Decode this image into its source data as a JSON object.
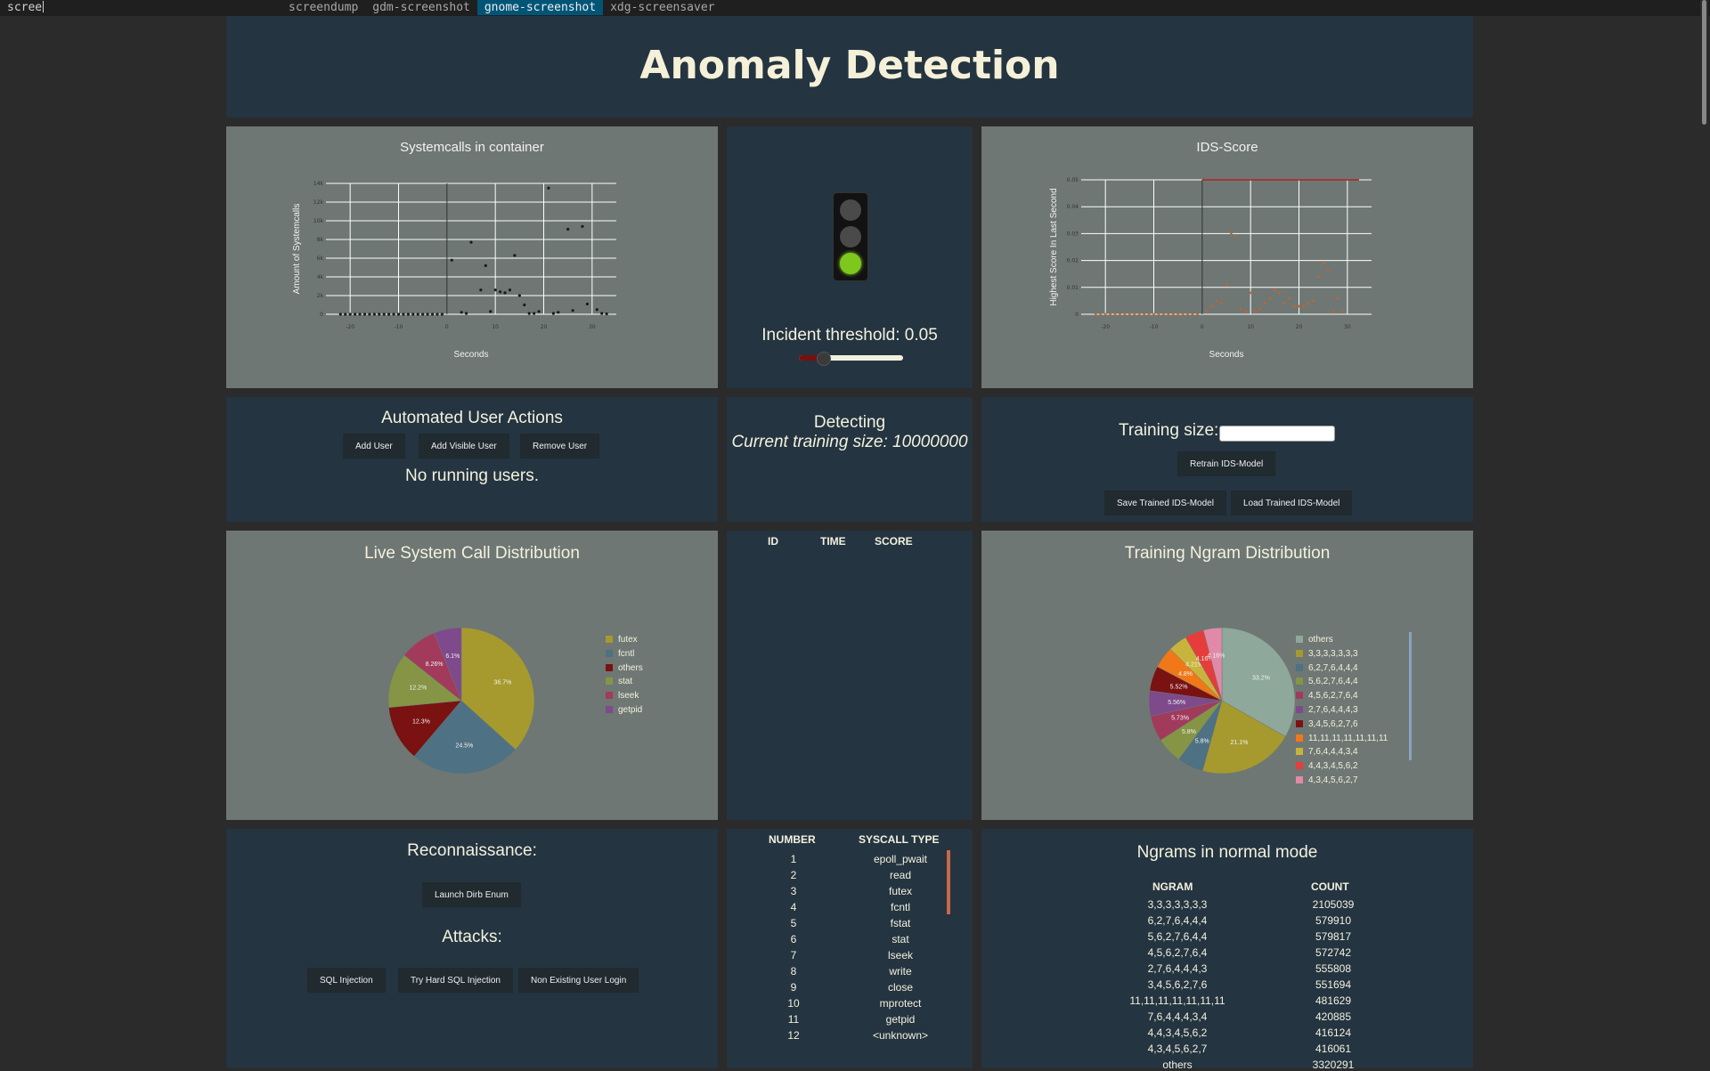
{
  "launcher": {
    "query": "scree",
    "items": [
      "screendump",
      "gdm-screenshot",
      "gnome-screenshot",
      "xdg-screensaver"
    ],
    "selected_index": 2
  },
  "header": {
    "title": "Anomaly Detection"
  },
  "syscall_chart": {
    "title": "Systemcalls in container",
    "chart_data": {
      "type": "scatter",
      "xlabel": "Seconds",
      "ylabel": "Amount of Systemcalls",
      "xlim": [
        -25,
        35
      ],
      "ylim": [
        0,
        14000
      ],
      "x_ticks": [
        "-20",
        "-10",
        "0",
        "10",
        "20",
        "30"
      ],
      "y_ticks": [
        "0",
        "2k",
        "4k",
        "6k",
        "8k",
        "10k",
        "12k",
        "14k"
      ],
      "grid": true,
      "points": [
        {
          "x": 1,
          "y": 5800
        },
        {
          "x": 3,
          "y": 200
        },
        {
          "x": 4,
          "y": 100
        },
        {
          "x": 5,
          "y": 7700
        },
        {
          "x": 7,
          "y": 2600
        },
        {
          "x": 8,
          "y": 5200
        },
        {
          "x": 9,
          "y": 300
        },
        {
          "x": 10,
          "y": 2600
        },
        {
          "x": 11,
          "y": 2400
        },
        {
          "x": 12,
          "y": 2300
        },
        {
          "x": 13,
          "y": 2600
        },
        {
          "x": 14,
          "y": 6300
        },
        {
          "x": 15,
          "y": 2000
        },
        {
          "x": 16,
          "y": 1000
        },
        {
          "x": 17,
          "y": 100
        },
        {
          "x": 18,
          "y": 100
        },
        {
          "x": 19,
          "y": 300
        },
        {
          "x": 21,
          "y": 13500
        },
        {
          "x": 22,
          "y": 100
        },
        {
          "x": 23,
          "y": 200
        },
        {
          "x": 25,
          "y": 9100
        },
        {
          "x": 26,
          "y": 400
        },
        {
          "x": 28,
          "y": 9400
        },
        {
          "x": 29,
          "y": 1100
        },
        {
          "x": 31,
          "y": 500
        },
        {
          "x": 32,
          "y": 100
        },
        {
          "x": 33,
          "y": 50
        }
      ]
    }
  },
  "traffic_light": {
    "state": "green",
    "threshold_label": "Incident threshold: 0.05",
    "slider_value_fraction": 0.2
  },
  "ids_chart": {
    "title": "IDS-Score",
    "chart_data": {
      "type": "scatter",
      "xlabel": "Seconds",
      "ylabel": "Highest Score In Last Second",
      "xlim": [
        -25,
        35
      ],
      "ylim": [
        0,
        0.05
      ],
      "threshold": 0.05,
      "x_ticks": [
        "-20",
        "-10",
        "0",
        "10",
        "20",
        "30"
      ],
      "y_ticks": [
        "0",
        "0.01",
        "0.02",
        "0.03",
        "0.04",
        "0.05"
      ],
      "grid": true,
      "points": [
        {
          "x": 1,
          "y": 0.001
        },
        {
          "x": 2,
          "y": 0.003
        },
        {
          "x": 3,
          "y": 0.005
        },
        {
          "x": 4,
          "y": 0.004
        },
        {
          "x": 5,
          "y": 0.011
        },
        {
          "x": 6,
          "y": 0.03
        },
        {
          "x": 7,
          "y": 0.029
        },
        {
          "x": 8,
          "y": 0.002
        },
        {
          "x": 9,
          "y": 0.001
        },
        {
          "x": 10,
          "y": 0.008
        },
        {
          "x": 11,
          "y": 0.001
        },
        {
          "x": 12,
          "y": 0.002
        },
        {
          "x": 13,
          "y": 0.004
        },
        {
          "x": 14,
          "y": 0.006
        },
        {
          "x": 15,
          "y": 0.009
        },
        {
          "x": 16,
          "y": 0.008
        },
        {
          "x": 17,
          "y": 0.004
        },
        {
          "x": 18,
          "y": 0.006
        },
        {
          "x": 19,
          "y": 0.003
        },
        {
          "x": 20,
          "y": 0.003
        },
        {
          "x": 21,
          "y": 0.003
        },
        {
          "x": 22,
          "y": 0.004
        },
        {
          "x": 23,
          "y": 0.005
        },
        {
          "x": 24,
          "y": 0.014
        },
        {
          "x": 25,
          "y": 0.019
        },
        {
          "x": 26,
          "y": 0.016
        },
        {
          "x": 27,
          "y": 0.001
        },
        {
          "x": 28,
          "y": 0.006
        },
        {
          "x": 29,
          "y": 0.001
        }
      ]
    }
  },
  "user_actions": {
    "title": "Automated User Actions",
    "buttons": [
      "Add User",
      "Add Visible User",
      "Remove User"
    ],
    "status": "No running users."
  },
  "detecting": {
    "status": "Detecting",
    "training_size_text": "Current training size: 10000000"
  },
  "training": {
    "label": "Training size:",
    "input_value": "",
    "retrain_label": "Retrain IDS-Model",
    "save_label": "Save Trained IDS-Model",
    "load_label": "Load Trained IDS-Model"
  },
  "live_distribution": {
    "title": "Live System Call Distribution",
    "chart_data": {
      "type": "pie",
      "slices": [
        {
          "label": "futex",
          "value": 36.7,
          "text": "36.7%",
          "color": "#a69a2e"
        },
        {
          "label": "fcntl",
          "value": 24.5,
          "text": "24.5%",
          "color": "#4e7183"
        },
        {
          "label": "others",
          "value": 12.3,
          "text": "12.3%",
          "color": "#7a1212"
        },
        {
          "label": "stat",
          "value": 12.2,
          "text": "12.2%",
          "color": "#859545"
        },
        {
          "label": "lseek",
          "value": 8.2,
          "text": "8.26%",
          "color": "#a23a5c"
        },
        {
          "label": "getpid",
          "value": 6.1,
          "text": "6.1%",
          "color": "#7e4a8b"
        }
      ]
    }
  },
  "incidents": {
    "headers": [
      "ID",
      "TIME",
      "SCORE"
    ],
    "rows": []
  },
  "training_ngram": {
    "title": "Training Ngram Distribution",
    "chart_data": {
      "type": "pie",
      "slices": [
        {
          "label": "others",
          "value": 33.2,
          "text": "33.2%",
          "color": "#8ea89b"
        },
        {
          "label": "3,3,3,3,3,3,3",
          "value": 21.1,
          "text": "21.1%",
          "color": "#a69a2e"
        },
        {
          "label": "6,2,7,6,4,4,4",
          "value": 5.8,
          "text": "5.8%",
          "color": "#4e7183"
        },
        {
          "label": "5,6,2,7,6,4,4",
          "value": 5.8,
          "text": "5.8%",
          "color": "#859545"
        },
        {
          "label": "4,5,6,2,7,6,4",
          "value": 5.7,
          "text": "5.73%",
          "color": "#a23a5c"
        },
        {
          "label": "2,7,6,4,4,4,3",
          "value": 5.6,
          "text": "5.56%",
          "color": "#7e4a8b"
        },
        {
          "label": "3,4,5,6,2,7,6",
          "value": 5.5,
          "text": "5.52%",
          "color": "#7a1212"
        },
        {
          "label": "11,11,11,11,11,11,11",
          "value": 4.8,
          "text": "4.8%",
          "color": "#f07818"
        },
        {
          "label": "7,6,4,4,4,3,4",
          "value": 4.2,
          "text": "4.21%",
          "color": "#c8b43c"
        },
        {
          "label": "4,4,3,4,5,6,2",
          "value": 4.2,
          "text": "4.16%",
          "color": "#e63c3c"
        },
        {
          "label": "4,3,4,5,6,2,7",
          "value": 4.1,
          "text": "4.16%",
          "color": "#e08aa8"
        }
      ]
    }
  },
  "attacks": {
    "recon_title": "Reconnaissance:",
    "recon_buttons": [
      "Launch Dirb Enum"
    ],
    "attacks_title": "Attacks:",
    "attack_buttons": [
      "SQL Injection",
      "Try Hard SQL Injection",
      "Non Existing User Login"
    ]
  },
  "syscall_table": {
    "headers": [
      "NUMBER",
      "SYSCALL TYPE"
    ],
    "rows": [
      [
        "1",
        "epoll_pwait"
      ],
      [
        "2",
        "read"
      ],
      [
        "3",
        "futex"
      ],
      [
        "4",
        "fcntl"
      ],
      [
        "5",
        "fstat"
      ],
      [
        "6",
        "stat"
      ],
      [
        "7",
        "lseek"
      ],
      [
        "8",
        "write"
      ],
      [
        "9",
        "close"
      ],
      [
        "10",
        "mprotect"
      ],
      [
        "11",
        "getpid"
      ],
      [
        "12",
        "<unknown>"
      ]
    ]
  },
  "ngrams_normal": {
    "title": "Ngrams in normal mode",
    "headers": [
      "NGRAM",
      "COUNT"
    ],
    "rows": [
      [
        "3,3,3,3,3,3,3",
        "2105039"
      ],
      [
        "6,2,7,6,4,4,4",
        "579910"
      ],
      [
        "5,6,2,7,6,4,4",
        "579817"
      ],
      [
        "4,5,6,2,7,6,4",
        "572742"
      ],
      [
        "2,7,6,4,4,4,3",
        "555808"
      ],
      [
        "3,4,5,6,2,7,6",
        "551694"
      ],
      [
        "11,11,11,11,11,11,11",
        "481629"
      ],
      [
        "7,6,4,4,4,3,4",
        "420885"
      ],
      [
        "4,4,3,4,5,6,2",
        "416124"
      ],
      [
        "4,3,4,5,6,2,7",
        "416061"
      ],
      [
        "others",
        "3320291"
      ]
    ]
  }
}
